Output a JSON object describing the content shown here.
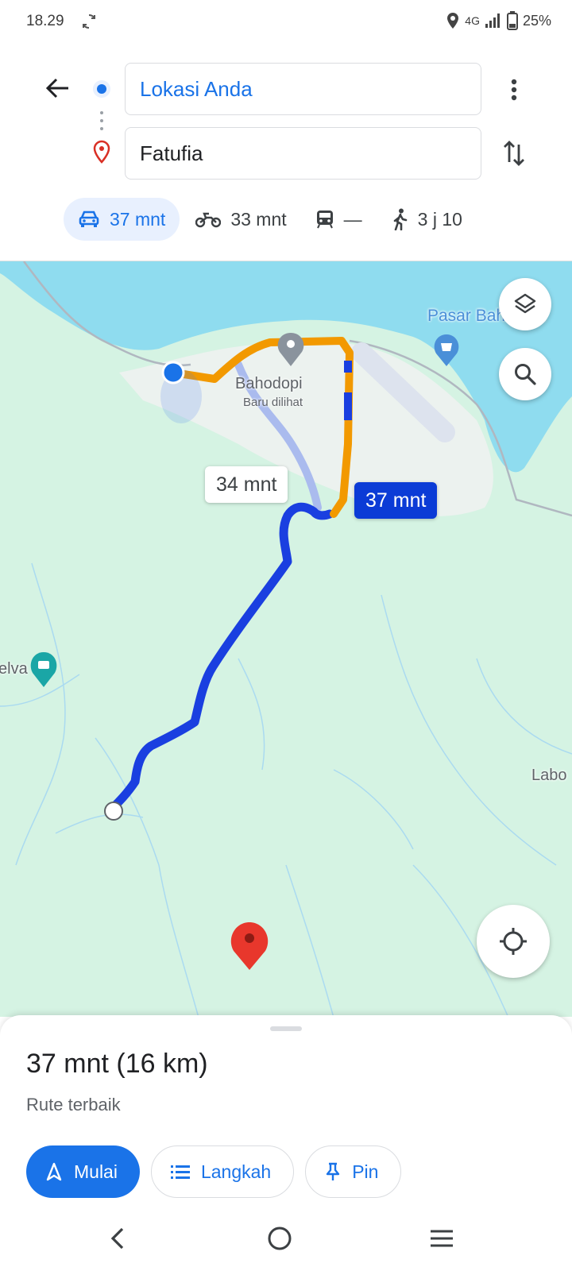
{
  "status": {
    "time": "18.29",
    "network": "4G",
    "battery": "25%"
  },
  "directions": {
    "origin_value": "Lokasi Anda",
    "destination_value": "Fatufia"
  },
  "modes": [
    {
      "icon": "car-icon",
      "label": "37 mnt",
      "active": true
    },
    {
      "icon": "motorcycle-icon",
      "label": "33 mnt",
      "active": false
    },
    {
      "icon": "transit-icon",
      "label": "—",
      "active": false
    },
    {
      "icon": "walk-icon",
      "label": "3 j 10",
      "active": false
    }
  ],
  "map": {
    "place_bahodopi": "Bahodopi",
    "place_bahodopi_sub": "Baru dilihat",
    "place_pasar": "Pasar Bahodopi",
    "place_elva": "elva",
    "place_labo": "Labo",
    "alt_route_time": "34 mnt",
    "main_route_time": "37 mnt",
    "colors": {
      "route_main": "#1a3fe0",
      "route_traffic": "#f29900",
      "route_alt": "#aabbee",
      "water": "#8fdcef",
      "land": "#d5f3e3"
    }
  },
  "sheet": {
    "summary": "37 mnt (16 km)",
    "note": "Rute terbaik",
    "start_label": "Mulai",
    "steps_label": "Langkah",
    "pin_label": "Pin"
  }
}
